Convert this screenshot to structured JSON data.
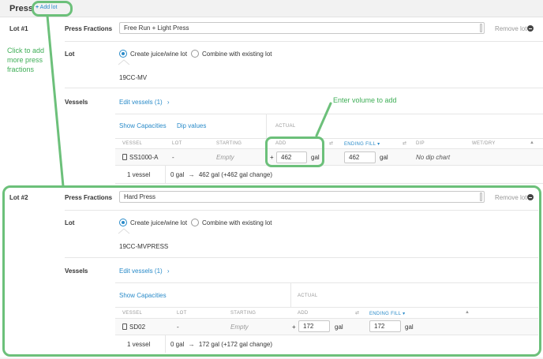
{
  "header": {
    "title": "Press",
    "add_lot_label": "Add lot"
  },
  "annotations": {
    "click_to_add": "Click to add more press fractions",
    "enter_volume": "Enter volume to add"
  },
  "lots": [
    {
      "name": "Lot #1",
      "press_fractions_label": "Press Fractions",
      "press_fraction_value": "Free Run + Light Press",
      "remove_label": "Remove lot",
      "lot_label": "Lot",
      "radio_create": "Create juice/wine lot",
      "radio_combine": "Combine with existing lot",
      "lot_code": "19CC-MV",
      "vessels_label": "Vessels",
      "edit_vessels": "Edit vessels (1)",
      "show_capacities": "Show Capacities",
      "dip_values": "Dip values",
      "actual_header": "ACTUAL",
      "columns": [
        "VESSEL",
        "LOT",
        "STARTING",
        "ADD",
        "ENDING FILL",
        "DIP",
        "WET/DRY"
      ],
      "row": {
        "vessel": "SS1000-A",
        "lot": "-",
        "starting": "Empty",
        "plus": "+",
        "add": "462",
        "add_unit": "gal",
        "ending": "462",
        "ending_unit": "gal",
        "dip": "No dip chart"
      },
      "footer_count": "1 vessel",
      "footer_change_from": "0 gal",
      "footer_arrow": "→",
      "footer_change_to": "462 gal (+462 gal change)"
    },
    {
      "name": "Lot #2",
      "press_fractions_label": "Press Fractions",
      "press_fraction_value": "Hard Press",
      "remove_label": "Remove lot",
      "lot_label": "Lot",
      "radio_create": "Create juice/wine lot",
      "radio_combine": "Combine with existing lot",
      "lot_code": "19CC-MVPRESS",
      "vessels_label": "Vessels",
      "edit_vessels": "Edit vessels (1)",
      "show_capacities": "Show Capacities",
      "actual_header": "ACTUAL",
      "columns": [
        "VESSEL",
        "LOT",
        "STARTING",
        "ADD",
        "ENDING FILL"
      ],
      "row": {
        "vessel": "SD02",
        "lot": "-",
        "starting": "Empty",
        "plus": "+",
        "add": "172",
        "add_unit": "gal",
        "ending": "172",
        "ending_unit": "gal"
      },
      "footer_count": "1 vessel",
      "footer_change_from": "0 gal",
      "footer_arrow": "→",
      "footer_change_to": "172 gal (+172 gal change)"
    }
  ],
  "colors": {
    "accent": "#2a8bc9",
    "annotation_green": "#6cc07a"
  }
}
